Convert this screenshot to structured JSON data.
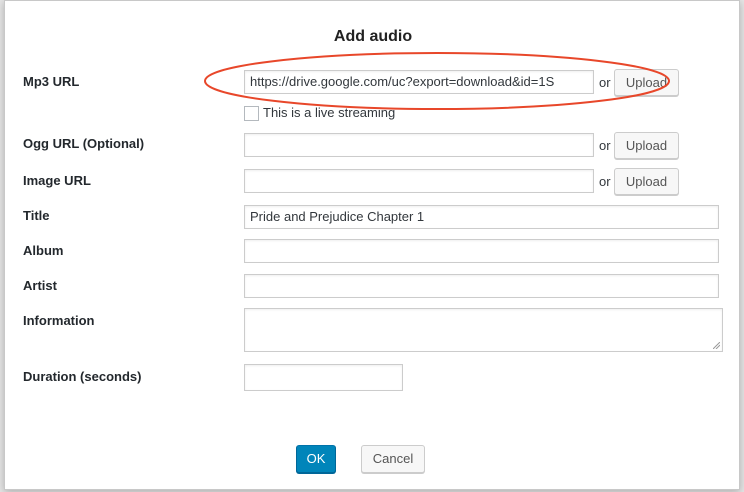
{
  "dialog": {
    "title": "Add audio",
    "fields": {
      "mp3_url": {
        "label": "Mp3 URL",
        "value": "https://drive.google.com/uc?export=download&id=1S"
      },
      "live_streaming": {
        "label": "This is a live streaming",
        "checked": false
      },
      "ogg_url": {
        "label": "Ogg URL (Optional)",
        "value": ""
      },
      "image_url": {
        "label": "Image URL",
        "value": ""
      },
      "title": {
        "label": "Title",
        "value": "Pride and Prejudice Chapter 1"
      },
      "album": {
        "label": "Album",
        "value": ""
      },
      "artist": {
        "label": "Artist",
        "value": ""
      },
      "information": {
        "label": "Information",
        "value": ""
      },
      "duration": {
        "label": "Duration (seconds)",
        "value": ""
      }
    },
    "or_text": "or",
    "upload_label": "Upload",
    "ok_label": "OK",
    "cancel_label": "Cancel"
  },
  "colors": {
    "primary": "#0085ba",
    "annotation": "#e8472a"
  }
}
